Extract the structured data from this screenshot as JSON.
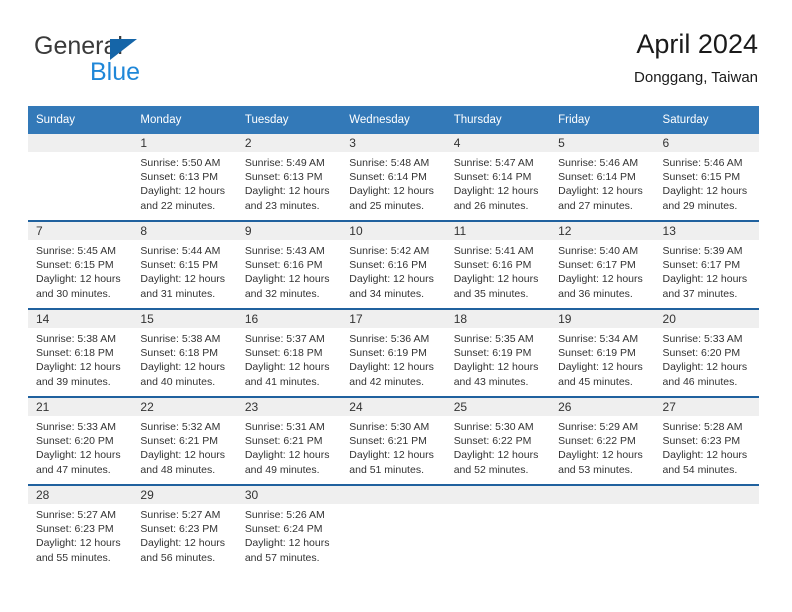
{
  "brand": {
    "name_part1": "General",
    "name_part2": "Blue",
    "triangle_color": "#1565a8",
    "blue_color": "#1f87d8"
  },
  "header": {
    "title": "April 2024",
    "location": "Donggang, Taiwan"
  },
  "calendar": {
    "header_bg": "#3379b8",
    "daynum_bg": "#efefef",
    "row_divider": "#20619e",
    "weekdays": [
      "Sunday",
      "Monday",
      "Tuesday",
      "Wednesday",
      "Thursday",
      "Friday",
      "Saturday"
    ],
    "weeks": [
      [
        {
          "day": "",
          "empty": true,
          "sunrise": "",
          "sunset": "",
          "daylight1": "",
          "daylight2": ""
        },
        {
          "day": "1",
          "empty": false,
          "sunrise": "Sunrise: 5:50 AM",
          "sunset": "Sunset: 6:13 PM",
          "daylight1": "Daylight: 12 hours",
          "daylight2": "and 22 minutes."
        },
        {
          "day": "2",
          "empty": false,
          "sunrise": "Sunrise: 5:49 AM",
          "sunset": "Sunset: 6:13 PM",
          "daylight1": "Daylight: 12 hours",
          "daylight2": "and 23 minutes."
        },
        {
          "day": "3",
          "empty": false,
          "sunrise": "Sunrise: 5:48 AM",
          "sunset": "Sunset: 6:14 PM",
          "daylight1": "Daylight: 12 hours",
          "daylight2": "and 25 minutes."
        },
        {
          "day": "4",
          "empty": false,
          "sunrise": "Sunrise: 5:47 AM",
          "sunset": "Sunset: 6:14 PM",
          "daylight1": "Daylight: 12 hours",
          "daylight2": "and 26 minutes."
        },
        {
          "day": "5",
          "empty": false,
          "sunrise": "Sunrise: 5:46 AM",
          "sunset": "Sunset: 6:14 PM",
          "daylight1": "Daylight: 12 hours",
          "daylight2": "and 27 minutes."
        },
        {
          "day": "6",
          "empty": false,
          "sunrise": "Sunrise: 5:46 AM",
          "sunset": "Sunset: 6:15 PM",
          "daylight1": "Daylight: 12 hours",
          "daylight2": "and 29 minutes."
        }
      ],
      [
        {
          "day": "7",
          "empty": false,
          "sunrise": "Sunrise: 5:45 AM",
          "sunset": "Sunset: 6:15 PM",
          "daylight1": "Daylight: 12 hours",
          "daylight2": "and 30 minutes."
        },
        {
          "day": "8",
          "empty": false,
          "sunrise": "Sunrise: 5:44 AM",
          "sunset": "Sunset: 6:15 PM",
          "daylight1": "Daylight: 12 hours",
          "daylight2": "and 31 minutes."
        },
        {
          "day": "9",
          "empty": false,
          "sunrise": "Sunrise: 5:43 AM",
          "sunset": "Sunset: 6:16 PM",
          "daylight1": "Daylight: 12 hours",
          "daylight2": "and 32 minutes."
        },
        {
          "day": "10",
          "empty": false,
          "sunrise": "Sunrise: 5:42 AM",
          "sunset": "Sunset: 6:16 PM",
          "daylight1": "Daylight: 12 hours",
          "daylight2": "and 34 minutes."
        },
        {
          "day": "11",
          "empty": false,
          "sunrise": "Sunrise: 5:41 AM",
          "sunset": "Sunset: 6:16 PM",
          "daylight1": "Daylight: 12 hours",
          "daylight2": "and 35 minutes."
        },
        {
          "day": "12",
          "empty": false,
          "sunrise": "Sunrise: 5:40 AM",
          "sunset": "Sunset: 6:17 PM",
          "daylight1": "Daylight: 12 hours",
          "daylight2": "and 36 minutes."
        },
        {
          "day": "13",
          "empty": false,
          "sunrise": "Sunrise: 5:39 AM",
          "sunset": "Sunset: 6:17 PM",
          "daylight1": "Daylight: 12 hours",
          "daylight2": "and 37 minutes."
        }
      ],
      [
        {
          "day": "14",
          "empty": false,
          "sunrise": "Sunrise: 5:38 AM",
          "sunset": "Sunset: 6:18 PM",
          "daylight1": "Daylight: 12 hours",
          "daylight2": "and 39 minutes."
        },
        {
          "day": "15",
          "empty": false,
          "sunrise": "Sunrise: 5:38 AM",
          "sunset": "Sunset: 6:18 PM",
          "daylight1": "Daylight: 12 hours",
          "daylight2": "and 40 minutes."
        },
        {
          "day": "16",
          "empty": false,
          "sunrise": "Sunrise: 5:37 AM",
          "sunset": "Sunset: 6:18 PM",
          "daylight1": "Daylight: 12 hours",
          "daylight2": "and 41 minutes."
        },
        {
          "day": "17",
          "empty": false,
          "sunrise": "Sunrise: 5:36 AM",
          "sunset": "Sunset: 6:19 PM",
          "daylight1": "Daylight: 12 hours",
          "daylight2": "and 42 minutes."
        },
        {
          "day": "18",
          "empty": false,
          "sunrise": "Sunrise: 5:35 AM",
          "sunset": "Sunset: 6:19 PM",
          "daylight1": "Daylight: 12 hours",
          "daylight2": "and 43 minutes."
        },
        {
          "day": "19",
          "empty": false,
          "sunrise": "Sunrise: 5:34 AM",
          "sunset": "Sunset: 6:19 PM",
          "daylight1": "Daylight: 12 hours",
          "daylight2": "and 45 minutes."
        },
        {
          "day": "20",
          "empty": false,
          "sunrise": "Sunrise: 5:33 AM",
          "sunset": "Sunset: 6:20 PM",
          "daylight1": "Daylight: 12 hours",
          "daylight2": "and 46 minutes."
        }
      ],
      [
        {
          "day": "21",
          "empty": false,
          "sunrise": "Sunrise: 5:33 AM",
          "sunset": "Sunset: 6:20 PM",
          "daylight1": "Daylight: 12 hours",
          "daylight2": "and 47 minutes."
        },
        {
          "day": "22",
          "empty": false,
          "sunrise": "Sunrise: 5:32 AM",
          "sunset": "Sunset: 6:21 PM",
          "daylight1": "Daylight: 12 hours",
          "daylight2": "and 48 minutes."
        },
        {
          "day": "23",
          "empty": false,
          "sunrise": "Sunrise: 5:31 AM",
          "sunset": "Sunset: 6:21 PM",
          "daylight1": "Daylight: 12 hours",
          "daylight2": "and 49 minutes."
        },
        {
          "day": "24",
          "empty": false,
          "sunrise": "Sunrise: 5:30 AM",
          "sunset": "Sunset: 6:21 PM",
          "daylight1": "Daylight: 12 hours",
          "daylight2": "and 51 minutes."
        },
        {
          "day": "25",
          "empty": false,
          "sunrise": "Sunrise: 5:30 AM",
          "sunset": "Sunset: 6:22 PM",
          "daylight1": "Daylight: 12 hours",
          "daylight2": "and 52 minutes."
        },
        {
          "day": "26",
          "empty": false,
          "sunrise": "Sunrise: 5:29 AM",
          "sunset": "Sunset: 6:22 PM",
          "daylight1": "Daylight: 12 hours",
          "daylight2": "and 53 minutes."
        },
        {
          "day": "27",
          "empty": false,
          "sunrise": "Sunrise: 5:28 AM",
          "sunset": "Sunset: 6:23 PM",
          "daylight1": "Daylight: 12 hours",
          "daylight2": "and 54 minutes."
        }
      ],
      [
        {
          "day": "28",
          "empty": false,
          "sunrise": "Sunrise: 5:27 AM",
          "sunset": "Sunset: 6:23 PM",
          "daylight1": "Daylight: 12 hours",
          "daylight2": "and 55 minutes."
        },
        {
          "day": "29",
          "empty": false,
          "sunrise": "Sunrise: 5:27 AM",
          "sunset": "Sunset: 6:23 PM",
          "daylight1": "Daylight: 12 hours",
          "daylight2": "and 56 minutes."
        },
        {
          "day": "30",
          "empty": false,
          "sunrise": "Sunrise: 5:26 AM",
          "sunset": "Sunset: 6:24 PM",
          "daylight1": "Daylight: 12 hours",
          "daylight2": "and 57 minutes."
        },
        {
          "day": "",
          "empty": true,
          "sunrise": "",
          "sunset": "",
          "daylight1": "",
          "daylight2": ""
        },
        {
          "day": "",
          "empty": true,
          "sunrise": "",
          "sunset": "",
          "daylight1": "",
          "daylight2": ""
        },
        {
          "day": "",
          "empty": true,
          "sunrise": "",
          "sunset": "",
          "daylight1": "",
          "daylight2": ""
        },
        {
          "day": "",
          "empty": true,
          "sunrise": "",
          "sunset": "",
          "daylight1": "",
          "daylight2": ""
        }
      ]
    ]
  }
}
